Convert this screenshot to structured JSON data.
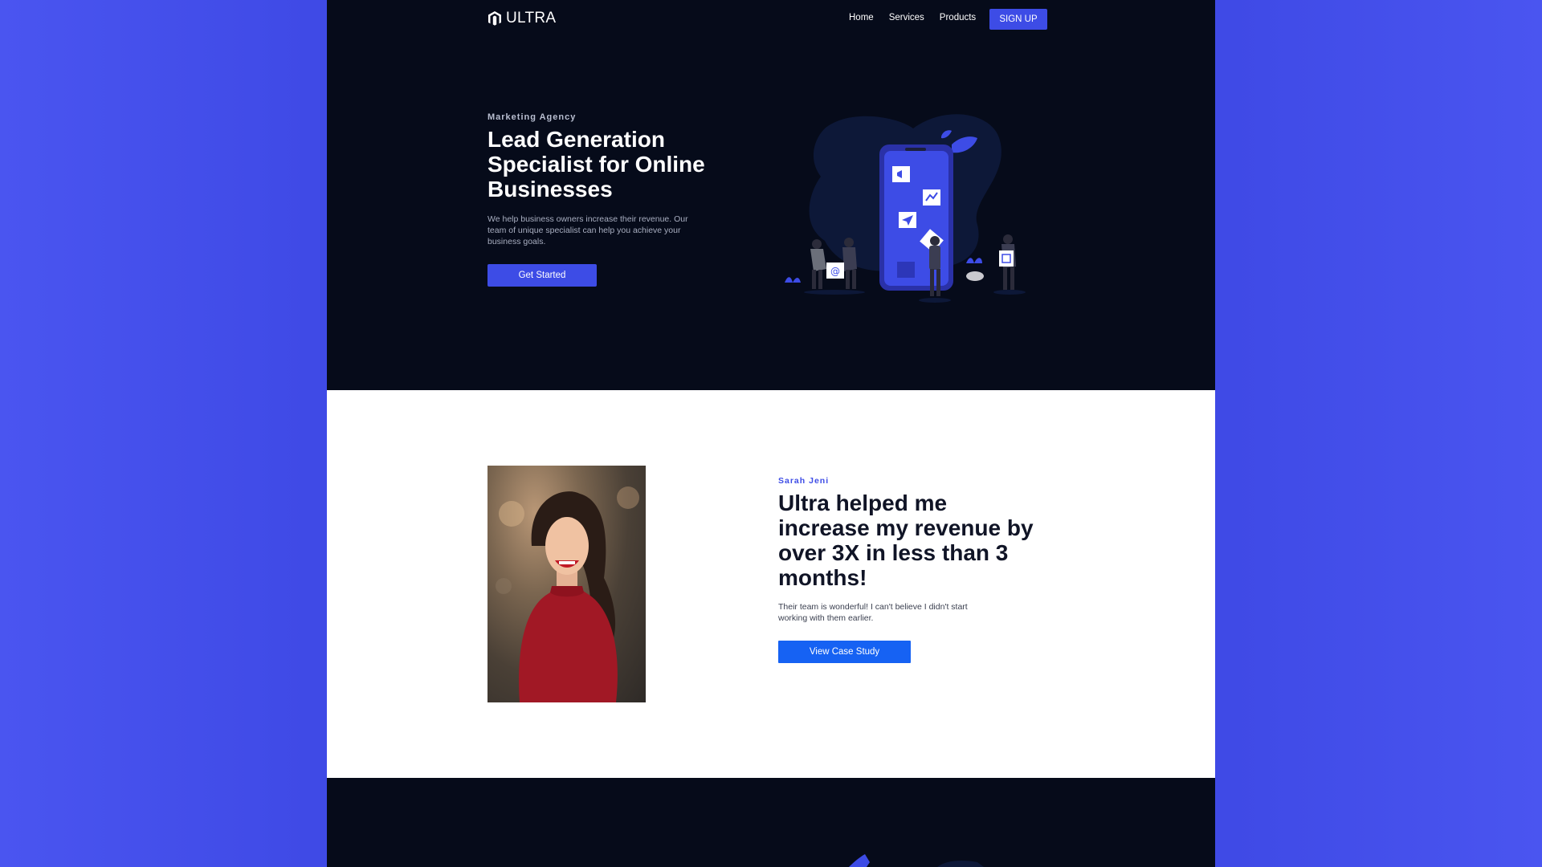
{
  "nav": {
    "brand": "ULTRA",
    "links": [
      "Home",
      "Services",
      "Products"
    ],
    "signup": "SIGN UP"
  },
  "hero": {
    "eyebrow": "Marketing Agency",
    "title": "Lead Generation Specialist for Online Businesses",
    "description": "We help business owners increase their revenue. Our team of unique specialist can help you achieve your business goals.",
    "cta": "Get Started"
  },
  "testimonial": {
    "name": "Sarah Jeni",
    "quote": "Ultra helped me increase my revenue by over 3X in less than 3 months!",
    "description": "Their team is wonderful! I can't believe I didn't start working with them earlier.",
    "cta": "View Case Study"
  },
  "colors": {
    "accent": "#3d4ce6",
    "case_study_button": "#1662f3",
    "dark_bg": "#060b1a",
    "outer_bg": "#4a55f0"
  }
}
